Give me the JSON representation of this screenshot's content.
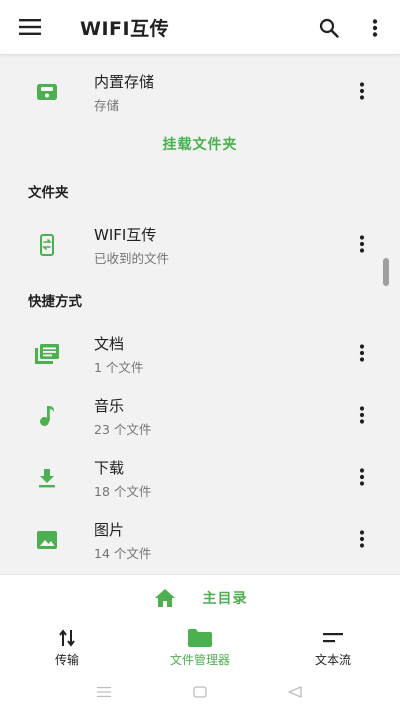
{
  "app_bar": {
    "title": "WIFI互传",
    "icons": {
      "menu": "menu-icon",
      "search": "search-icon",
      "more": "more-vert-icon"
    }
  },
  "storage": {
    "title": "内置存储",
    "subtitle": "存储",
    "icon": "sd-card-icon"
  },
  "mount_folder_link": "挂载文件夹",
  "folders_section": {
    "label": "文件夹",
    "items": [
      {
        "title": "WIFI互传",
        "subtitle": "已收到的文件",
        "icon": "phone-transfer-icon"
      }
    ]
  },
  "shortcuts_section": {
    "label": "快捷方式",
    "items": [
      {
        "title": "文档",
        "subtitle": "1 个文件",
        "icon": "documents-icon"
      },
      {
        "title": "音乐",
        "subtitle": "23 个文件",
        "icon": "music-note-icon"
      },
      {
        "title": "下载",
        "subtitle": "18 个文件",
        "icon": "download-icon"
      },
      {
        "title": "图片",
        "subtitle": "14 个文件",
        "icon": "image-icon"
      }
    ]
  },
  "home_bar": {
    "label": "主目录",
    "icon": "home-icon"
  },
  "bottom_nav": {
    "items": [
      {
        "label": "传输",
        "icon": "swap-vert-icon",
        "active": false
      },
      {
        "label": "文件管理器",
        "icon": "folder-icon",
        "active": true
      },
      {
        "label": "文本流",
        "icon": "short-text-icon",
        "active": false
      }
    ]
  },
  "colors": {
    "accent": "#4caf50",
    "background": "#f2f2f2",
    "surface": "#ffffff",
    "text": "#212121",
    "secondary_text": "#757575"
  }
}
